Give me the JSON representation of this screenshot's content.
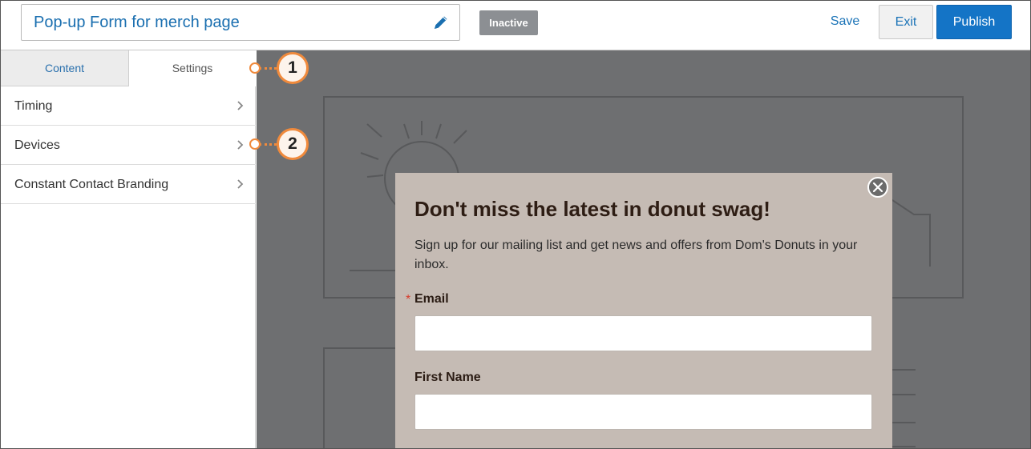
{
  "header": {
    "title": "Pop-up Form for merch page",
    "status": "Inactive",
    "save_label": "Save",
    "exit_label": "Exit",
    "publish_label": "Publish"
  },
  "sidebar": {
    "tabs": [
      {
        "label": "Content",
        "active": false
      },
      {
        "label": "Settings",
        "active": true
      }
    ],
    "items": [
      {
        "label": "Timing"
      },
      {
        "label": "Devices"
      },
      {
        "label": "Constant Contact Branding"
      }
    ]
  },
  "popup": {
    "title": "Don't miss the latest in donut swag!",
    "description": "Sign up for our mailing list and get news and offers from Dom's Donuts in your inbox.",
    "required_marker": "*",
    "fields": [
      {
        "label": "Email",
        "value": ""
      },
      {
        "label": "First Name",
        "value": ""
      }
    ]
  },
  "callouts": [
    "1",
    "2"
  ],
  "colors": {
    "accent": "#1474c6",
    "callout": "#f08a3c",
    "canvas": "#6e6f71",
    "popup_bg": "#c5bbb4"
  }
}
